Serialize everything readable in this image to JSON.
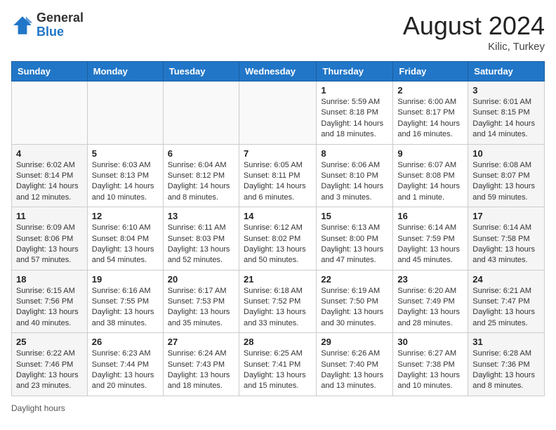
{
  "header": {
    "logo_general": "General",
    "logo_blue": "Blue",
    "month_year": "August 2024",
    "location": "Kilic, Turkey"
  },
  "days_of_week": [
    "Sunday",
    "Monday",
    "Tuesday",
    "Wednesday",
    "Thursday",
    "Friday",
    "Saturday"
  ],
  "legend_text": "Daylight hours",
  "weeks": [
    [
      {
        "day": "",
        "info": ""
      },
      {
        "day": "",
        "info": ""
      },
      {
        "day": "",
        "info": ""
      },
      {
        "day": "",
        "info": ""
      },
      {
        "day": "1",
        "info": "Sunrise: 5:59 AM\nSunset: 8:18 PM\nDaylight: 14 hours\nand 18 minutes."
      },
      {
        "day": "2",
        "info": "Sunrise: 6:00 AM\nSunset: 8:17 PM\nDaylight: 14 hours\nand 16 minutes."
      },
      {
        "day": "3",
        "info": "Sunrise: 6:01 AM\nSunset: 8:15 PM\nDaylight: 14 hours\nand 14 minutes."
      }
    ],
    [
      {
        "day": "4",
        "info": "Sunrise: 6:02 AM\nSunset: 8:14 PM\nDaylight: 14 hours\nand 12 minutes."
      },
      {
        "day": "5",
        "info": "Sunrise: 6:03 AM\nSunset: 8:13 PM\nDaylight: 14 hours\nand 10 minutes."
      },
      {
        "day": "6",
        "info": "Sunrise: 6:04 AM\nSunset: 8:12 PM\nDaylight: 14 hours\nand 8 minutes."
      },
      {
        "day": "7",
        "info": "Sunrise: 6:05 AM\nSunset: 8:11 PM\nDaylight: 14 hours\nand 6 minutes."
      },
      {
        "day": "8",
        "info": "Sunrise: 6:06 AM\nSunset: 8:10 PM\nDaylight: 14 hours\nand 3 minutes."
      },
      {
        "day": "9",
        "info": "Sunrise: 6:07 AM\nSunset: 8:08 PM\nDaylight: 14 hours\nand 1 minute."
      },
      {
        "day": "10",
        "info": "Sunrise: 6:08 AM\nSunset: 8:07 PM\nDaylight: 13 hours\nand 59 minutes."
      }
    ],
    [
      {
        "day": "11",
        "info": "Sunrise: 6:09 AM\nSunset: 8:06 PM\nDaylight: 13 hours\nand 57 minutes."
      },
      {
        "day": "12",
        "info": "Sunrise: 6:10 AM\nSunset: 8:04 PM\nDaylight: 13 hours\nand 54 minutes."
      },
      {
        "day": "13",
        "info": "Sunrise: 6:11 AM\nSunset: 8:03 PM\nDaylight: 13 hours\nand 52 minutes."
      },
      {
        "day": "14",
        "info": "Sunrise: 6:12 AM\nSunset: 8:02 PM\nDaylight: 13 hours\nand 50 minutes."
      },
      {
        "day": "15",
        "info": "Sunrise: 6:13 AM\nSunset: 8:00 PM\nDaylight: 13 hours\nand 47 minutes."
      },
      {
        "day": "16",
        "info": "Sunrise: 6:14 AM\nSunset: 7:59 PM\nDaylight: 13 hours\nand 45 minutes."
      },
      {
        "day": "17",
        "info": "Sunrise: 6:14 AM\nSunset: 7:58 PM\nDaylight: 13 hours\nand 43 minutes."
      }
    ],
    [
      {
        "day": "18",
        "info": "Sunrise: 6:15 AM\nSunset: 7:56 PM\nDaylight: 13 hours\nand 40 minutes."
      },
      {
        "day": "19",
        "info": "Sunrise: 6:16 AM\nSunset: 7:55 PM\nDaylight: 13 hours\nand 38 minutes."
      },
      {
        "day": "20",
        "info": "Sunrise: 6:17 AM\nSunset: 7:53 PM\nDaylight: 13 hours\nand 35 minutes."
      },
      {
        "day": "21",
        "info": "Sunrise: 6:18 AM\nSunset: 7:52 PM\nDaylight: 13 hours\nand 33 minutes."
      },
      {
        "day": "22",
        "info": "Sunrise: 6:19 AM\nSunset: 7:50 PM\nDaylight: 13 hours\nand 30 minutes."
      },
      {
        "day": "23",
        "info": "Sunrise: 6:20 AM\nSunset: 7:49 PM\nDaylight: 13 hours\nand 28 minutes."
      },
      {
        "day": "24",
        "info": "Sunrise: 6:21 AM\nSunset: 7:47 PM\nDaylight: 13 hours\nand 25 minutes."
      }
    ],
    [
      {
        "day": "25",
        "info": "Sunrise: 6:22 AM\nSunset: 7:46 PM\nDaylight: 13 hours\nand 23 minutes."
      },
      {
        "day": "26",
        "info": "Sunrise: 6:23 AM\nSunset: 7:44 PM\nDaylight: 13 hours\nand 20 minutes."
      },
      {
        "day": "27",
        "info": "Sunrise: 6:24 AM\nSunset: 7:43 PM\nDaylight: 13 hours\nand 18 minutes."
      },
      {
        "day": "28",
        "info": "Sunrise: 6:25 AM\nSunset: 7:41 PM\nDaylight: 13 hours\nand 15 minutes."
      },
      {
        "day": "29",
        "info": "Sunrise: 6:26 AM\nSunset: 7:40 PM\nDaylight: 13 hours\nand 13 minutes."
      },
      {
        "day": "30",
        "info": "Sunrise: 6:27 AM\nSunset: 7:38 PM\nDaylight: 13 hours\nand 10 minutes."
      },
      {
        "day": "31",
        "info": "Sunrise: 6:28 AM\nSunset: 7:36 PM\nDaylight: 13 hours\nand 8 minutes."
      }
    ]
  ]
}
